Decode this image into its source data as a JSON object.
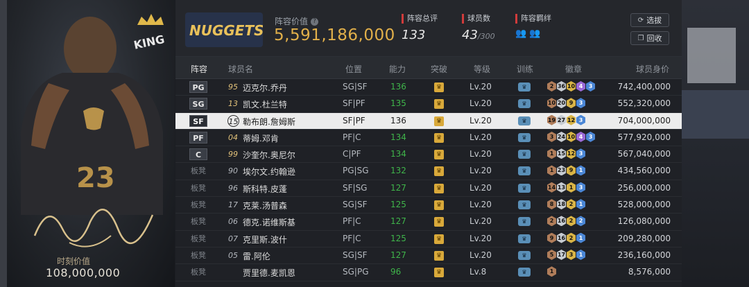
{
  "card": {
    "value_label": "时刻价值",
    "value": "108,000,000",
    "logo_text": "KING"
  },
  "header": {
    "team_logo_text": "NUGGETS",
    "team_value_label": "阵容价值",
    "team_value": "5,591,186,000",
    "rating_label": "阵容总评",
    "rating": "133",
    "count_label": "球员数",
    "count": "43",
    "count_max": "/300",
    "bonds_label": "阵容羁绊",
    "btn_select": "选拔",
    "btn_recycle": "回收"
  },
  "columns": [
    "阵容",
    "球员名",
    "位置",
    "能力",
    "突破",
    "等级",
    "训练",
    "徽章",
    "球员身价"
  ],
  "rows": [
    {
      "slot": "PG",
      "starter": true,
      "jersey": "95",
      "name": "迈克尔.乔丹",
      "pos": "SG|SF",
      "ability": "136",
      "level": "Lv.20",
      "badges": [
        [
          "br",
          "2"
        ],
        [
          "sv",
          "36"
        ],
        [
          "gd",
          "10"
        ],
        [
          "pu",
          "4"
        ],
        [
          "bl",
          "3"
        ]
      ],
      "price": "742,400,000"
    },
    {
      "slot": "SG",
      "starter": true,
      "jersey": "13",
      "name": "凯文.杜兰特",
      "pos": "SF|PF",
      "ability": "135",
      "level": "Lv.20",
      "badges": [
        [
          "br",
          "10"
        ],
        [
          "sv",
          "20"
        ],
        [
          "gd",
          "9"
        ],
        [
          "bl",
          "3"
        ]
      ],
      "price": "552,320,000"
    },
    {
      "slot": "SF",
      "starter": true,
      "selected": true,
      "jersey": "15",
      "name": "勒布朗.詹姆斯",
      "pos": "SF|PF",
      "ability": "136",
      "level": "Lv.20",
      "badges": [
        [
          "br",
          "19"
        ],
        [
          "sv",
          "27"
        ],
        [
          "gd",
          "12"
        ],
        [
          "bl",
          "3"
        ]
      ],
      "price": "704,000,000"
    },
    {
      "slot": "PF",
      "starter": true,
      "jersey": "04",
      "name": "蒂姆.邓肯",
      "pos": "PF|C",
      "ability": "134",
      "level": "Lv.20",
      "badges": [
        [
          "br",
          "3"
        ],
        [
          "sv",
          "24"
        ],
        [
          "gd",
          "10"
        ],
        [
          "pu",
          "4"
        ],
        [
          "bl",
          "3"
        ]
      ],
      "price": "577,920,000"
    },
    {
      "slot": "C",
      "starter": true,
      "jersey": "99",
      "name": "沙奎尔.奥尼尔",
      "pos": "C|PF",
      "ability": "134",
      "level": "Lv.20",
      "badges": [
        [
          "br",
          "1"
        ],
        [
          "sv",
          "15"
        ],
        [
          "gd",
          "12"
        ],
        [
          "bl",
          "3"
        ]
      ],
      "price": "567,040,000"
    },
    {
      "slot": "板凳",
      "starter": false,
      "jersey": "90",
      "name": "埃尔文.约翰逊",
      "pos": "PG|SG",
      "ability": "132",
      "level": "Lv.20",
      "badges": [
        [
          "br",
          "1"
        ],
        [
          "sv",
          "23"
        ],
        [
          "gd",
          "9"
        ],
        [
          "bl",
          "1"
        ]
      ],
      "price": "434,560,000"
    },
    {
      "slot": "板凳",
      "starter": false,
      "jersey": "96",
      "name": "斯科特.皮蓬",
      "pos": "SF|SG",
      "ability": "127",
      "level": "Lv.20",
      "badges": [
        [
          "br",
          "14"
        ],
        [
          "sv",
          "13"
        ],
        [
          "gd",
          "1"
        ],
        [
          "bl",
          "3"
        ]
      ],
      "price": "256,000,000"
    },
    {
      "slot": "板凳",
      "starter": false,
      "jersey": "17",
      "name": "克莱.汤普森",
      "pos": "SG|SF",
      "ability": "125",
      "level": "Lv.20",
      "badges": [
        [
          "br",
          "8"
        ],
        [
          "sv",
          "18"
        ],
        [
          "gd",
          "2"
        ],
        [
          "bl",
          "1"
        ]
      ],
      "price": "528,000,000"
    },
    {
      "slot": "板凳",
      "starter": false,
      "jersey": "06",
      "name": "德克.诺维斯基",
      "pos": "PF|C",
      "ability": "127",
      "level": "Lv.20",
      "badges": [
        [
          "br",
          "2"
        ],
        [
          "sv",
          "16"
        ],
        [
          "gd",
          "2"
        ],
        [
          "bl",
          "2"
        ]
      ],
      "price": "126,080,000"
    },
    {
      "slot": "板凳",
      "starter": false,
      "jersey": "07",
      "name": "克里斯.波什",
      "pos": "PF|C",
      "ability": "125",
      "level": "Lv.20",
      "badges": [
        [
          "br",
          "9"
        ],
        [
          "sv",
          "16"
        ],
        [
          "gd",
          "2"
        ],
        [
          "bl",
          "1"
        ]
      ],
      "price": "209,280,000"
    },
    {
      "slot": "板凳",
      "starter": false,
      "jersey": "05",
      "name": "雷.阿伦",
      "pos": "SG|SF",
      "ability": "127",
      "level": "Lv.20",
      "badges": [
        [
          "br",
          "5"
        ],
        [
          "sv",
          "17"
        ],
        [
          "gd",
          "3"
        ],
        [
          "bl",
          "1"
        ]
      ],
      "price": "236,160,000"
    },
    {
      "slot": "板凳",
      "starter": false,
      "jersey": "",
      "name": "贾里德.麦凯恩",
      "pos": "SG|PG",
      "ability": "96",
      "level": "Lv.8",
      "badges": [
        [
          "br",
          "1"
        ]
      ],
      "price": "8,576,000"
    }
  ]
}
